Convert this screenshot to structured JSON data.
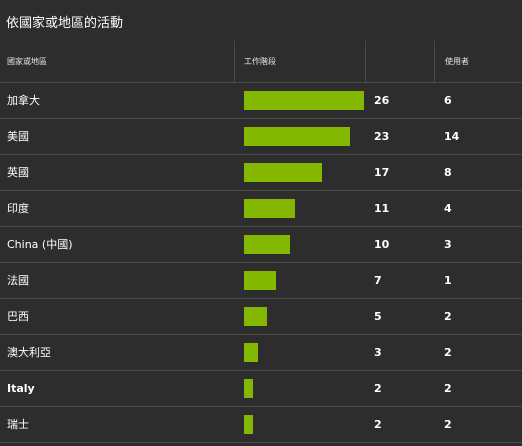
{
  "title": "依國家或地區的活動",
  "headers": {
    "country": "國家或地區",
    "workstage": "工作階段",
    "users": "使用者"
  },
  "colors": {
    "background": "#2d2d2d",
    "bar": "#84b800",
    "divider": "#4a4a4a"
  },
  "rows": [
    {
      "country": "加拿大",
      "sessions": 26,
      "users": 6
    },
    {
      "country": "美國",
      "sessions": 23,
      "users": 14
    },
    {
      "country": "英國",
      "sessions": 17,
      "users": 8
    },
    {
      "country": "印度",
      "sessions": 11,
      "users": 4
    },
    {
      "country": "China (中國)",
      "sessions": 10,
      "users": 3
    },
    {
      "country": "法國",
      "sessions": 7,
      "users": 1
    },
    {
      "country": "巴西",
      "sessions": 5,
      "users": 2
    },
    {
      "country": "澳大利亞",
      "sessions": 3,
      "users": 2
    },
    {
      "country": "Italy",
      "sessions": 2,
      "users": 2
    },
    {
      "country": "瑞士",
      "sessions": 2,
      "users": 2
    }
  ]
}
